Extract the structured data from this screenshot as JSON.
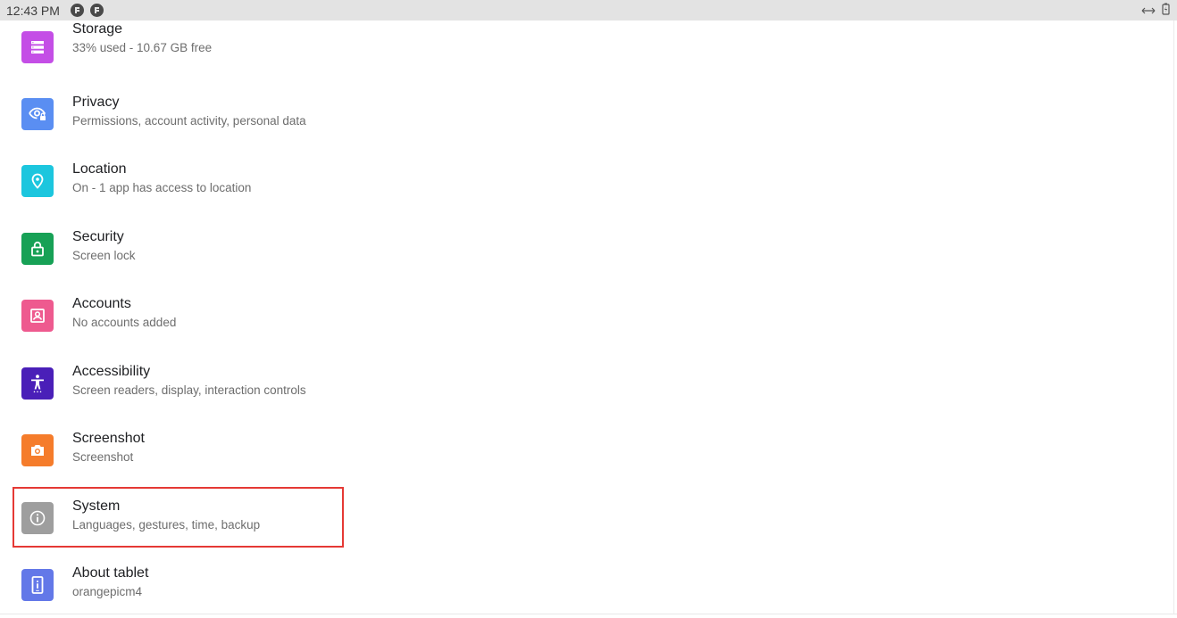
{
  "status_bar": {
    "time": "12:43 PM",
    "notification_icons": [
      "notification-app-icon",
      "notification-app-icon"
    ],
    "right_icons": [
      "data-transfer-icon",
      "battery-charging-icon"
    ]
  },
  "settings": {
    "items": [
      {
        "title": "Storage",
        "subtitle": "33% used - 10.67 GB free",
        "icon": "storage-icon",
        "color": "#c44ee6"
      },
      {
        "title": "Privacy",
        "subtitle": "Permissions, account activity, personal data",
        "icon": "privacy-icon",
        "color": "#5a8ef2"
      },
      {
        "title": "Location",
        "subtitle": "On - 1 app has access to location",
        "icon": "location-icon",
        "color": "#1cc6de"
      },
      {
        "title": "Security",
        "subtitle": "Screen lock",
        "icon": "lock-icon",
        "color": "#17a156"
      },
      {
        "title": "Accounts",
        "subtitle": "No accounts added",
        "icon": "account-icon",
        "color": "#ee5a8f"
      },
      {
        "title": "Accessibility",
        "subtitle": "Screen readers, display, interaction controls",
        "icon": "accessibility-icon",
        "color": "#4a1fb8"
      },
      {
        "title": "Screenshot",
        "subtitle": "Screenshot",
        "icon": "camera-icon",
        "color": "#f57c2b"
      },
      {
        "title": "System",
        "subtitle": "Languages, gestures, time, backup",
        "icon": "info-icon",
        "color": "#9e9e9e"
      },
      {
        "title": "About tablet",
        "subtitle": "orangepicm4",
        "icon": "tablet-info-icon",
        "color": "#6378e8"
      }
    ]
  },
  "highlight": {
    "target": "System",
    "color": "#e53935"
  }
}
